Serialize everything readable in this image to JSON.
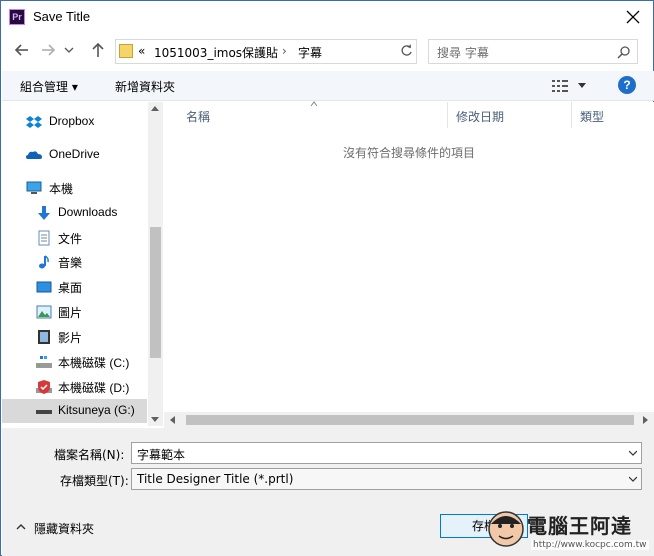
{
  "window": {
    "title": "Save Title",
    "app_icon_text": "Pr"
  },
  "address": {
    "overflow": "«",
    "crumbs": [
      "1051003_imos保護貼",
      "字幕"
    ],
    "separator": "›"
  },
  "search": {
    "placeholder": "搜尋 字幕"
  },
  "toolbar": {
    "organize": "組合管理 ▾",
    "new_folder": "新增資料夾",
    "help": "?"
  },
  "nav_pane": {
    "items": [
      {
        "label": "Dropbox",
        "icon": "dropbox-icon"
      },
      {
        "label": "OneDrive",
        "icon": "onedrive-icon"
      },
      {
        "label": "本機",
        "icon": "computer-icon"
      },
      {
        "label": "Downloads",
        "icon": "downloads-icon"
      },
      {
        "label": "文件",
        "icon": "documents-icon"
      },
      {
        "label": "音樂",
        "icon": "music-icon"
      },
      {
        "label": "桌面",
        "icon": "desktop-icon"
      },
      {
        "label": "圖片",
        "icon": "pictures-icon"
      },
      {
        "label": "影片",
        "icon": "videos-icon"
      },
      {
        "label": "本機磁碟 (C:)",
        "icon": "drive-c-icon"
      },
      {
        "label": "本機磁碟 (D:)",
        "icon": "drive-d-icon"
      },
      {
        "label": "Kitsuneya (G:)",
        "icon": "drive-g-icon",
        "selected": true
      }
    ]
  },
  "file_list": {
    "columns": [
      "名稱",
      "修改日期",
      "類型"
    ],
    "empty_message": "沒有符合搜尋條件的項目"
  },
  "form": {
    "filename_label": "檔案名稱(N):",
    "filename_value": "字幕範本",
    "filetype_label": "存檔類型(T):",
    "filetype_value": "Title Designer Title (*.prtl)",
    "hide_folders": "隱藏資料夾",
    "save_button": "存檔"
  },
  "watermark": {
    "text": "電腦王阿達",
    "url": "http://www.kocpc.com.tw"
  },
  "colors": {
    "accent": "#0078d7",
    "toolbar_bg": "#f3f6fb",
    "help_blue": "#1e6fcc",
    "selected_bg": "#d9d9d9"
  }
}
